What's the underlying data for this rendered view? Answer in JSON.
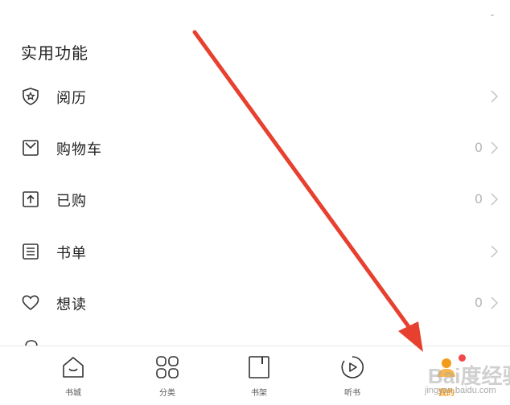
{
  "section": {
    "title": "实用功能"
  },
  "menu": [
    {
      "icon": "shield-star-icon",
      "label": "阅历",
      "count": ""
    },
    {
      "icon": "shopping-bag-icon",
      "label": "购物车",
      "count": "0"
    },
    {
      "icon": "purchased-upload-icon",
      "label": "已购",
      "count": "0"
    },
    {
      "icon": "list-icon",
      "label": "书单",
      "count": ""
    },
    {
      "icon": "heart-icon",
      "label": "想读",
      "count": "0"
    }
  ],
  "tabs": [
    {
      "icon": "bookstore-icon",
      "label": "书城",
      "active": false
    },
    {
      "icon": "grid-category-icon",
      "label": "分类",
      "active": false
    },
    {
      "icon": "bookshelf-icon",
      "label": "书架",
      "active": false
    },
    {
      "icon": "play-listen-icon",
      "label": "听书",
      "active": false
    },
    {
      "icon": "profile-icon",
      "label": "我的",
      "active": true
    }
  ],
  "colors": {
    "accent": "#f29b1b",
    "arrow": "#e8402f",
    "badge": "#f2474b"
  },
  "watermark": {
    "text": "Bai度经验",
    "sub": "jingyan.baidu.com"
  }
}
